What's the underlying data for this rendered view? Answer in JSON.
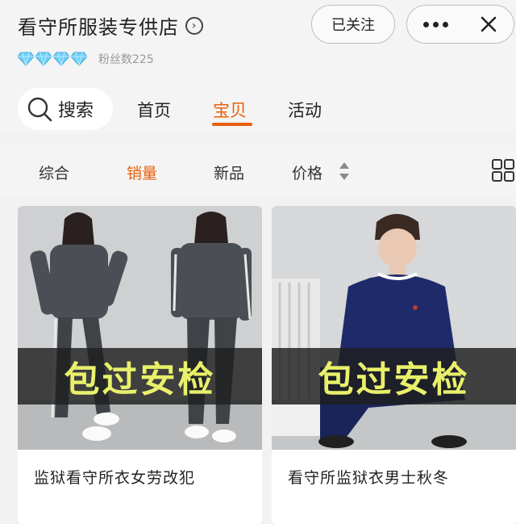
{
  "header": {
    "shop_name": "看守所服装专供店",
    "fans_text": "粉丝数225",
    "follow_label": "已关注",
    "level_diamonds": 4
  },
  "nav": {
    "search_label": "搜索",
    "tabs": [
      "首页",
      "宝贝",
      "活动"
    ],
    "active_tab": "宝贝"
  },
  "sort": {
    "items": [
      "综合",
      "销量",
      "新品",
      "价格"
    ],
    "active": "销量"
  },
  "products": [
    {
      "name": "监狱看守所衣女劳改犯",
      "banner": "包过安检"
    },
    {
      "name": "看守所监狱衣男士秋冬",
      "banner": "包过安检"
    }
  ],
  "colors": {
    "accent": "#e9600b",
    "banner_text": "#e9f06a",
    "diamond": "#6fd0f5"
  }
}
